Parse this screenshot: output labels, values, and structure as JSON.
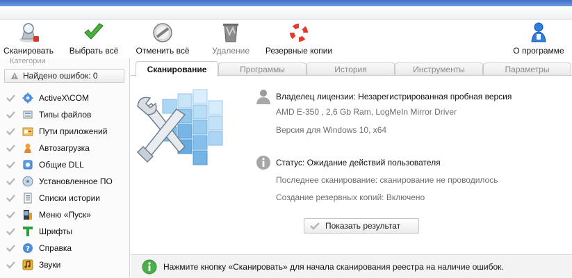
{
  "toolbar": {
    "scan": "Сканировать",
    "select_all": "Выбрать всё",
    "deselect_all": "Отменить всё",
    "delete": "Удаление",
    "backups": "Резервные копии",
    "about": "О программе"
  },
  "sidebar": {
    "legend": "Категории",
    "found_errors": "Найдено ошибок: 0",
    "items": [
      {
        "label": "ActiveX\\COM",
        "icon": "gear-icon"
      },
      {
        "label": "Типы файлов",
        "icon": "file-types-icon"
      },
      {
        "label": "Пути приложений",
        "icon": "app-paths-icon"
      },
      {
        "label": "Автозагрузка",
        "icon": "startup-icon"
      },
      {
        "label": "Общие DLL",
        "icon": "shared-dll-icon"
      },
      {
        "label": "Установленное ПО",
        "icon": "installed-software-icon"
      },
      {
        "label": "Списки истории",
        "icon": "history-lists-icon"
      },
      {
        "label": "Меню «Пуск»",
        "icon": "start-menu-icon"
      },
      {
        "label": "Шрифты",
        "icon": "fonts-icon"
      },
      {
        "label": "Справка",
        "icon": "help-icon"
      },
      {
        "label": "Звуки",
        "icon": "sounds-icon"
      }
    ]
  },
  "tabs": [
    "Сканирование",
    "Программы",
    "История",
    "Инструменты",
    "Параметры"
  ],
  "main": {
    "license_owner": "Владелец лицензии: Незарегистрированная пробная версия",
    "system_info": "AMD E-350 , 2,6 Gb Ram, LogMeIn Mirror Driver",
    "version": "Версия для Windows 10, x64",
    "status": "Статус: Ожидание действий пользователя",
    "last_scan": "Последнее сканирование: сканирование не проводилось",
    "backup_state": "Создание резервных копий: Включено",
    "show_results": "Показать результат"
  },
  "status_bar": {
    "message": "Нажмите кнопку «Сканировать» для начала сканирования реестра на наличие ошибок."
  },
  "colors": {
    "title_blue": "#3f6fc8",
    "check_green": "#3aa53a",
    "info_green": "#49b04a"
  }
}
